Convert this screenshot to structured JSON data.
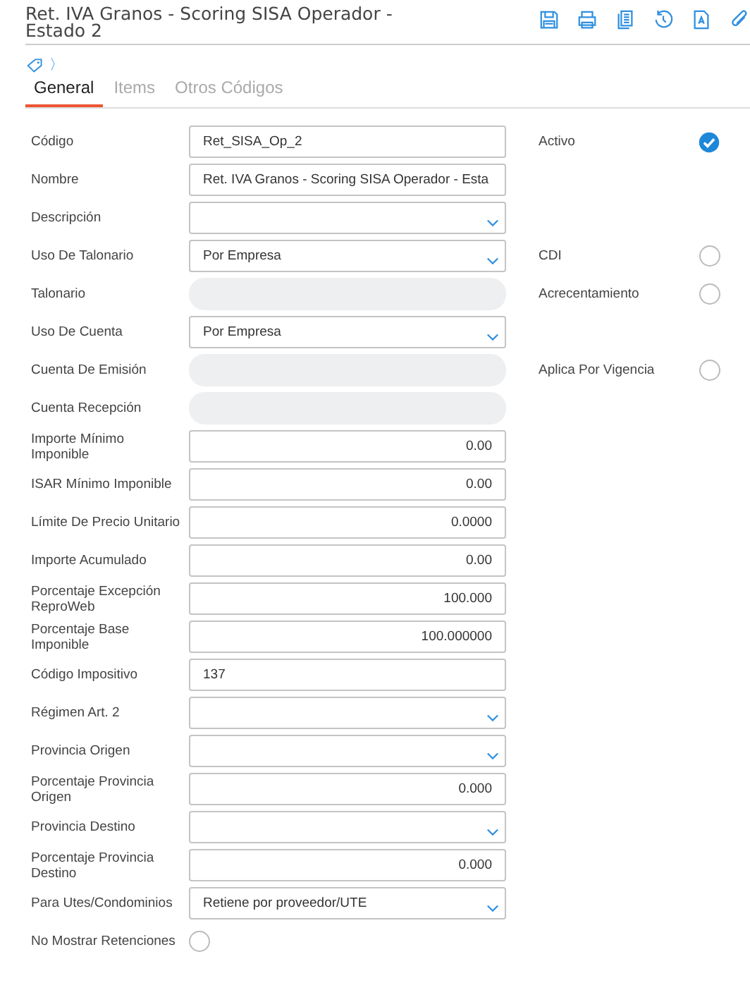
{
  "header": {
    "title": "Ret. IVA Granos - Scoring SISA Operador - Estado 2"
  },
  "toolbar": [
    {
      "kind": "save"
    },
    {
      "kind": "print"
    },
    {
      "kind": "copy"
    },
    {
      "kind": "history"
    },
    {
      "kind": "document"
    },
    {
      "kind": "attach"
    }
  ],
  "breadcrumb": {
    "separator": "〉"
  },
  "tabs": [
    {
      "label": "General",
      "selected": true
    },
    {
      "label": "Items",
      "selected": false
    },
    {
      "label": "Otros Códigos",
      "selected": false
    }
  ],
  "fields": [
    {
      "label": "Código",
      "kind": "text",
      "value": "Ret_SISA_Op_2",
      "side": {
        "label": "Activo",
        "checked": true
      }
    },
    {
      "label": "Nombre",
      "kind": "text",
      "value": "Ret. IVA Granos - Scoring SISA Operador - Esta"
    },
    {
      "label": "Descripción",
      "kind": "select"
    },
    {
      "label": "Uso De Talonario",
      "kind": "select",
      "value": "Por Empresa",
      "side": {
        "label": "CDI",
        "checked": false
      }
    },
    {
      "label": "Talonario",
      "kind": "disabled",
      "side": {
        "label": "Acrecentamiento",
        "checked": false
      }
    },
    {
      "label": "Uso De Cuenta",
      "kind": "select",
      "value": "Por Empresa"
    },
    {
      "label": "Cuenta De Emisión",
      "kind": "disabled",
      "side": {
        "label": "Aplica Por Vigencia",
        "checked": false
      }
    },
    {
      "label": "Cuenta Recepción",
      "kind": "disabled"
    },
    {
      "label": "Importe Mínimo Imponible",
      "kind": "number",
      "value": "0.00"
    },
    {
      "label": "ISAR Mínimo Imponible",
      "kind": "number",
      "value": "0.00"
    },
    {
      "label": "Límite De Precio Unitario",
      "kind": "number",
      "value": "0.0000"
    },
    {
      "label": "Importe Acumulado",
      "kind": "number",
      "value": "0.00"
    },
    {
      "label": "Porcentaje Excepción ReproWeb",
      "kind": "number",
      "value": "100.000"
    },
    {
      "label": "Porcentaje Base Imponible",
      "kind": "number",
      "value": "100.000000"
    },
    {
      "label": "Código Impositivo",
      "kind": "text",
      "value": "137"
    },
    {
      "label": "Régimen Art. 2",
      "kind": "select"
    },
    {
      "label": "Provincia Origen",
      "kind": "select"
    },
    {
      "label": "Porcentaje Provincia Origen",
      "kind": "number",
      "value": "0.000"
    },
    {
      "label": "Provincia Destino",
      "kind": "select"
    },
    {
      "label": "Porcentaje Provincia Destino",
      "kind": "number",
      "value": "0.000"
    },
    {
      "label": "Para Utes/Condominios",
      "kind": "select",
      "value": "Retiene por proveedor/UTE"
    },
    {
      "label": "No Mostrar Retenciones",
      "kind": "radio",
      "checked": false
    }
  ]
}
